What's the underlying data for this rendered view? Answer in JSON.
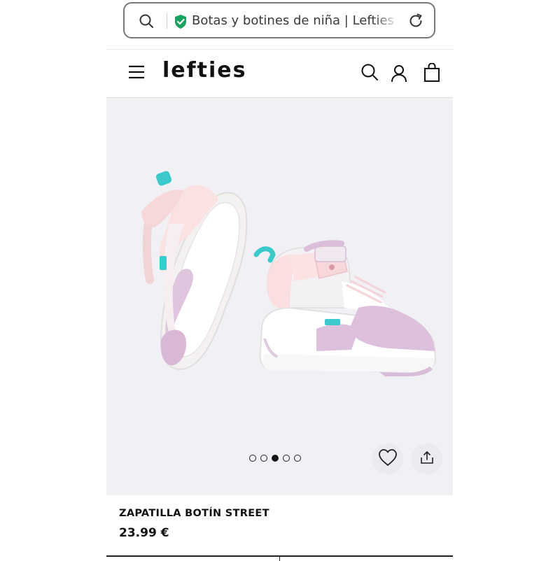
{
  "browser": {
    "url_text": "Botas y botines de niña | Lefties M",
    "icons": {
      "search": "search-icon",
      "secure": "shield-check-icon",
      "reload": "reload-icon"
    },
    "secure_color": "#1aa260"
  },
  "header": {
    "logo": "lefties",
    "icons": {
      "menu": "hamburger-menu-icon",
      "search": "search-icon",
      "account": "user-icon",
      "bag": "shopping-bag-icon"
    }
  },
  "gallery": {
    "image": "pink-white-high-top-sneakers",
    "pager": {
      "count": 5,
      "active_index": 2
    },
    "actions": {
      "favorite": "heart-icon",
      "share": "share-icon"
    },
    "background": "#f1f1f5"
  },
  "product": {
    "name": "ZAPATILLA BOTÍN STREET",
    "price": "23.99 €"
  }
}
